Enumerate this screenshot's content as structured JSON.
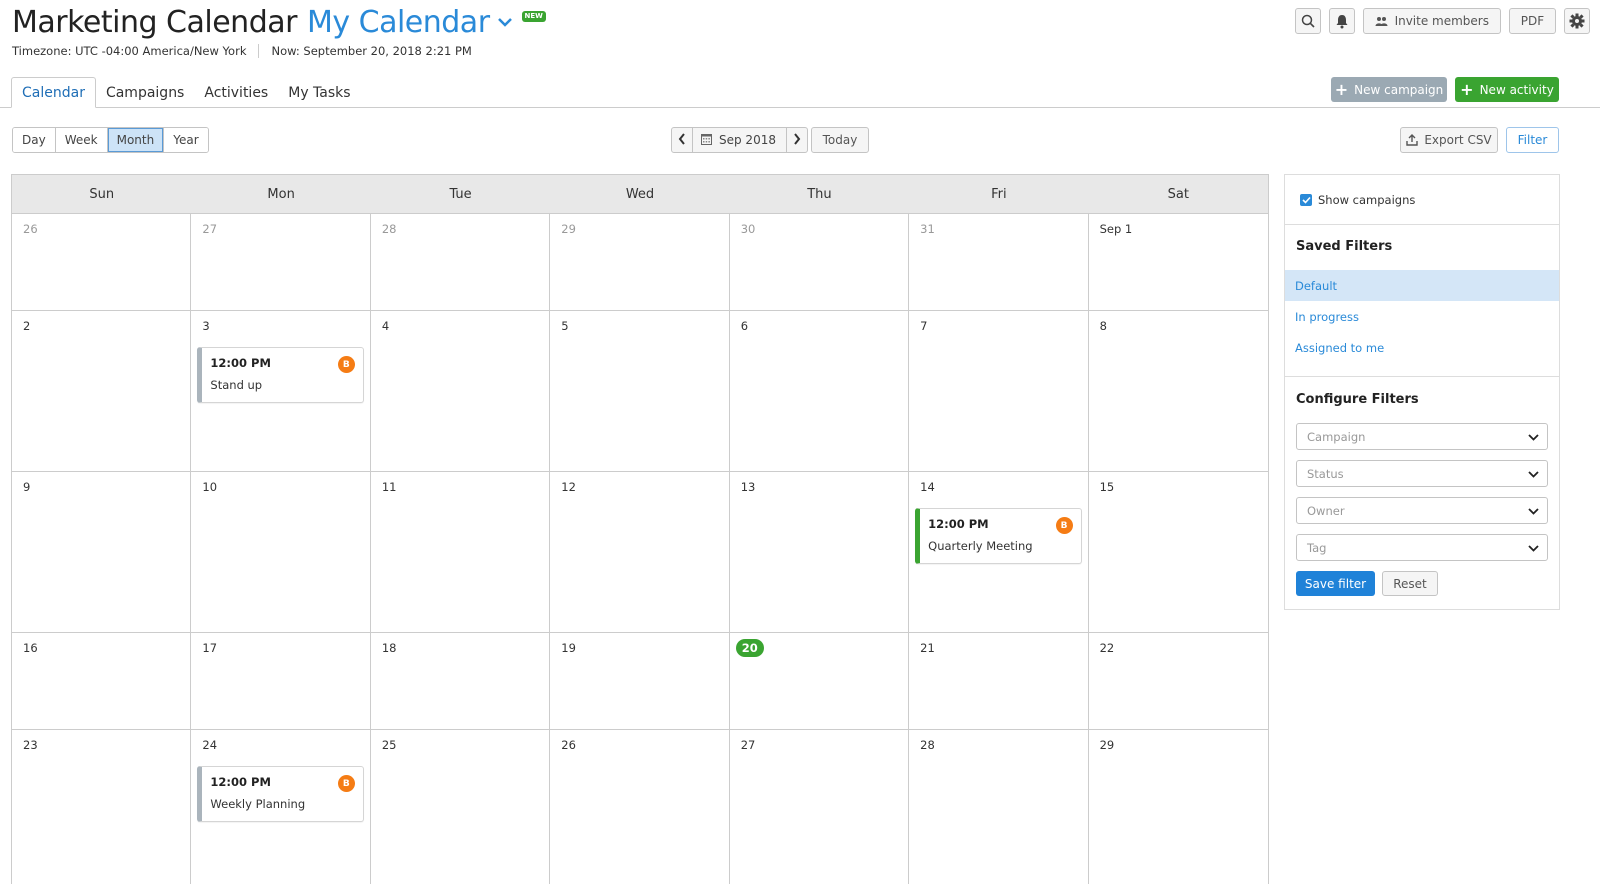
{
  "header": {
    "title": "Marketing Calendar",
    "calendar_name": "My Calendar",
    "new_badge": "NEW",
    "timezone": "Timezone: UTC -04:00 America/New York",
    "now": "Now: September 20, 2018 2:21 PM"
  },
  "top_actions": {
    "search_icon": "search-icon",
    "notifications_icon": "bell-icon",
    "invite_label": "Invite members",
    "pdf_label": "PDF",
    "settings_icon": "gear-icon"
  },
  "tabs": [
    {
      "label": "Calendar",
      "active": true
    },
    {
      "label": "Campaigns",
      "active": false
    },
    {
      "label": "Activities",
      "active": false
    },
    {
      "label": "My Tasks",
      "active": false
    }
  ],
  "actions": {
    "new_campaign": "New campaign",
    "new_activity": "New activity"
  },
  "view_modes": [
    {
      "label": "Day",
      "active": false
    },
    {
      "label": "Week",
      "active": false
    },
    {
      "label": "Month",
      "active": true
    },
    {
      "label": "Year",
      "active": false
    }
  ],
  "navigation": {
    "current_period": "Sep 2018",
    "today_label": "Today"
  },
  "toolbar": {
    "export_label": "Export CSV",
    "filter_label": "Filter"
  },
  "calendar": {
    "weekdays": [
      "Sun",
      "Mon",
      "Tue",
      "Wed",
      "Thu",
      "Fri",
      "Sat"
    ],
    "weeks": [
      [
        {
          "d": "26",
          "muted": true
        },
        {
          "d": "27",
          "muted": true
        },
        {
          "d": "28",
          "muted": true
        },
        {
          "d": "29",
          "muted": true
        },
        {
          "d": "30",
          "muted": true
        },
        {
          "d": "31",
          "muted": true
        },
        {
          "d": "Sep 1"
        }
      ],
      [
        {
          "d": "2"
        },
        {
          "d": "3",
          "event": {
            "time": "12:00 PM",
            "title": "Stand up",
            "owner": "B",
            "color": "gray"
          }
        },
        {
          "d": "4"
        },
        {
          "d": "5"
        },
        {
          "d": "6"
        },
        {
          "d": "7"
        },
        {
          "d": "8"
        }
      ],
      [
        {
          "d": "9"
        },
        {
          "d": "10"
        },
        {
          "d": "11"
        },
        {
          "d": "12"
        },
        {
          "d": "13"
        },
        {
          "d": "14",
          "event": {
            "time": "12:00 PM",
            "title": "Quarterly Meeting",
            "owner": "B",
            "color": "green"
          }
        },
        {
          "d": "15"
        }
      ],
      [
        {
          "d": "16"
        },
        {
          "d": "17"
        },
        {
          "d": "18"
        },
        {
          "d": "19"
        },
        {
          "d": "20",
          "today": true
        },
        {
          "d": "21"
        },
        {
          "d": "22"
        }
      ],
      [
        {
          "d": "23"
        },
        {
          "d": "24",
          "event": {
            "time": "12:00 PM",
            "title": "Weekly Planning",
            "owner": "B",
            "color": "gray"
          }
        },
        {
          "d": "25"
        },
        {
          "d": "26"
        },
        {
          "d": "27"
        },
        {
          "d": "28"
        },
        {
          "d": "29"
        }
      ]
    ]
  },
  "sidebar": {
    "show_campaigns": "Show campaigns",
    "show_campaigns_checked": true,
    "saved_filters_title": "Saved Filters",
    "saved_filters": [
      {
        "label": "Default",
        "active": true
      },
      {
        "label": "In progress",
        "active": false
      },
      {
        "label": "Assigned to me",
        "active": false
      }
    ],
    "configure_title": "Configure Filters",
    "selects": [
      {
        "placeholder": "Campaign"
      },
      {
        "placeholder": "Status"
      },
      {
        "placeholder": "Owner"
      },
      {
        "placeholder": "Tag"
      }
    ],
    "save_filter": "Save filter",
    "reset": "Reset"
  },
  "colors": {
    "accent_blue": "#2a8ad8",
    "green": "#3aa431",
    "avatar_orange": "#f57c14"
  }
}
